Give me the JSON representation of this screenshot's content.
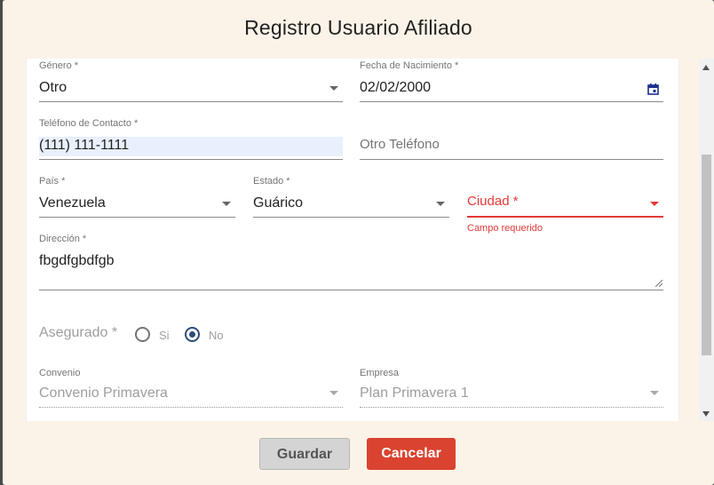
{
  "dialog": {
    "title": "Registro Usuario Afiliado"
  },
  "form": {
    "genero": {
      "label": "Género *",
      "value": "Otro"
    },
    "fecha": {
      "label": "Fecha de Nacimiento *",
      "value": "02/02/2000",
      "icon": "calendar-icon"
    },
    "telefono": {
      "label": "Teléfono de Contacto *",
      "value": "(111) 111-1111"
    },
    "otro_telefono": {
      "placeholder": "Otro Teléfono"
    },
    "pais": {
      "label": "País *",
      "value": "Venezuela"
    },
    "estado": {
      "label": "Estado *",
      "value": "Guárico"
    },
    "ciudad": {
      "label": "Ciudad *",
      "error": "Campo requerido"
    },
    "direccion": {
      "label": "Dirección *",
      "value": "fbgdfgbdfgb"
    },
    "asegurado": {
      "label": "Asegurado *",
      "options": [
        "Si",
        "No"
      ],
      "selected": "No"
    },
    "convenio": {
      "label": "Convenio",
      "value": "Convenio Primavera"
    },
    "empresa": {
      "label": "Empresa",
      "value": "Plan Primavera 1"
    }
  },
  "buttons": {
    "save": "Guardar",
    "cancel": "Cancelar"
  },
  "colors": {
    "accent": "#2c4d7a",
    "error": "#e53935",
    "cancel_button": "#d9432f",
    "dialog_background": "#fbf3e8"
  }
}
